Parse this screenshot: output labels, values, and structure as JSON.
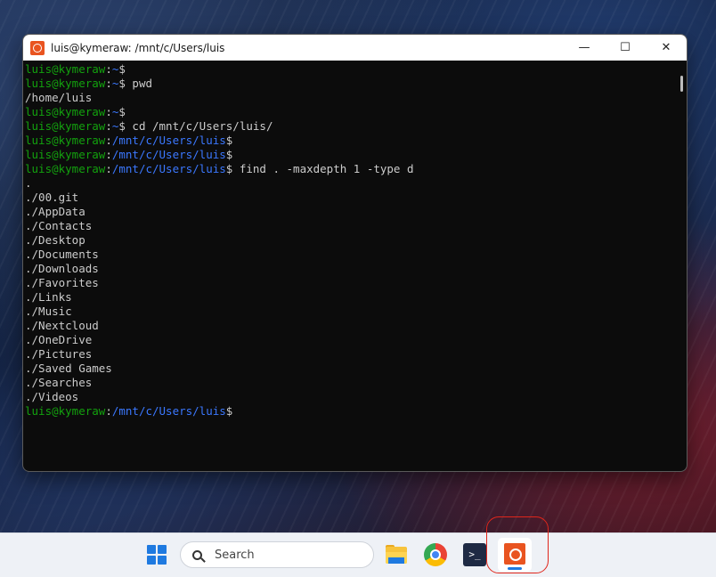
{
  "window": {
    "title": "luis@kymeraw: /mnt/c/Users/luis",
    "controls": {
      "minimize": "—",
      "maximize": "☐",
      "close": "✕"
    }
  },
  "terminal": {
    "colors": {
      "user": "#13a10e",
      "path": "#3b78ff",
      "text": "#cccccc",
      "background": "#0c0c0c"
    },
    "lines": [
      {
        "user": "luis@kymeraw",
        "sep": ":",
        "path": "~",
        "cmd": "$"
      },
      {
        "user": "luis@kymeraw",
        "sep": ":",
        "path": "~",
        "cmd": "$ pwd"
      },
      {
        "text": "/home/luis"
      },
      {
        "user": "luis@kymeraw",
        "sep": ":",
        "path": "~",
        "cmd": "$"
      },
      {
        "user": "luis@kymeraw",
        "sep": ":",
        "path": "~",
        "cmd": "$ cd /mnt/c/Users/luis/"
      },
      {
        "user": "luis@kymeraw",
        "sep": ":",
        "path": "/mnt/c/Users/luis",
        "cmd": "$"
      },
      {
        "user": "luis@kymeraw",
        "sep": ":",
        "path": "/mnt/c/Users/luis",
        "cmd": "$"
      },
      {
        "user": "luis@kymeraw",
        "sep": ":",
        "path": "/mnt/c/Users/luis",
        "cmd": "$ find . -maxdepth 1 -type d"
      },
      {
        "text": "."
      },
      {
        "text": "./00.git"
      },
      {
        "text": "./AppData"
      },
      {
        "text": "./Contacts"
      },
      {
        "text": "./Desktop"
      },
      {
        "text": "./Documents"
      },
      {
        "text": "./Downloads"
      },
      {
        "text": "./Favorites"
      },
      {
        "text": "./Links"
      },
      {
        "text": "./Music"
      },
      {
        "text": "./Nextcloud"
      },
      {
        "text": "./OneDrive"
      },
      {
        "text": "./Pictures"
      },
      {
        "text": "./Saved Games"
      },
      {
        "text": "./Searches"
      },
      {
        "text": "./Videos"
      },
      {
        "user": "luis@kymeraw",
        "sep": ":",
        "path": "/mnt/c/Users/luis",
        "cmd": "$"
      }
    ]
  },
  "taskbar": {
    "search": {
      "placeholder": "Search"
    },
    "pwsh_glyph": ">_",
    "apps": [
      "start-icon",
      "file-explorer-icon",
      "chrome-icon",
      "powershell-icon",
      "ubuntu-icon"
    ]
  }
}
